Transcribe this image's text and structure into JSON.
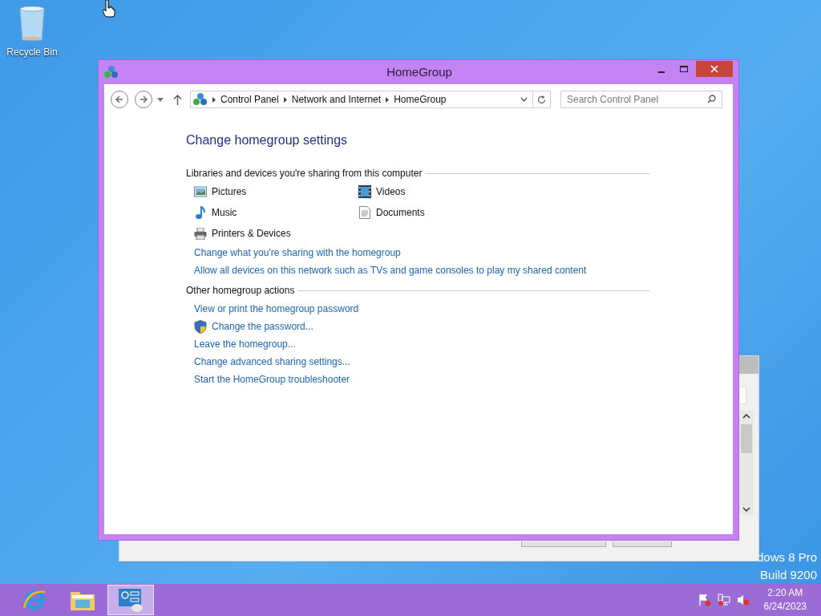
{
  "desktop": {
    "icons": [
      {
        "label": "Recycle Bin"
      }
    ],
    "watermark": [
      "dows 8 Pro",
      "Build 9200"
    ]
  },
  "window": {
    "title": "HomeGroup",
    "breadcrumb": [
      "Control Panel",
      "Network and Internet",
      "HomeGroup"
    ],
    "search": {
      "placeholder": "Search Control Panel"
    },
    "heading": "Change homegroup settings",
    "sections": [
      {
        "title": "Libraries and devices you're sharing from this computer",
        "items": [
          {
            "label": "Pictures",
            "kind": "pictures"
          },
          {
            "label": "Videos",
            "kind": "videos"
          },
          {
            "label": "Music",
            "kind": "music"
          },
          {
            "label": "Documents",
            "kind": "documents"
          },
          {
            "label": "Printers & Devices",
            "kind": "printers"
          }
        ],
        "links": [
          {
            "label": "Change what you're sharing with the homegroup",
            "shield": false
          },
          {
            "label": "Allow all devices on this network such as TVs and game consoles to play my shared content",
            "shield": false
          }
        ]
      },
      {
        "title": "Other homegroup actions",
        "links": [
          {
            "label": "View or print the homegroup password",
            "shield": false
          },
          {
            "label": "Change the password...",
            "shield": true
          },
          {
            "label": "Leave the homegroup...",
            "shield": false
          },
          {
            "label": "Change advanced sharing settings...",
            "shield": false
          },
          {
            "label": "Start the HomeGroup troubleshooter",
            "shield": false
          }
        ]
      }
    ]
  },
  "taskbar": {
    "apps": [
      {
        "kind": "browser",
        "selected": false
      },
      {
        "kind": "folder",
        "selected": false
      },
      {
        "kind": "control-panel",
        "selected": true
      }
    ],
    "clock": {
      "time": "2:20 AM",
      "date": "6/24/2023"
    }
  }
}
